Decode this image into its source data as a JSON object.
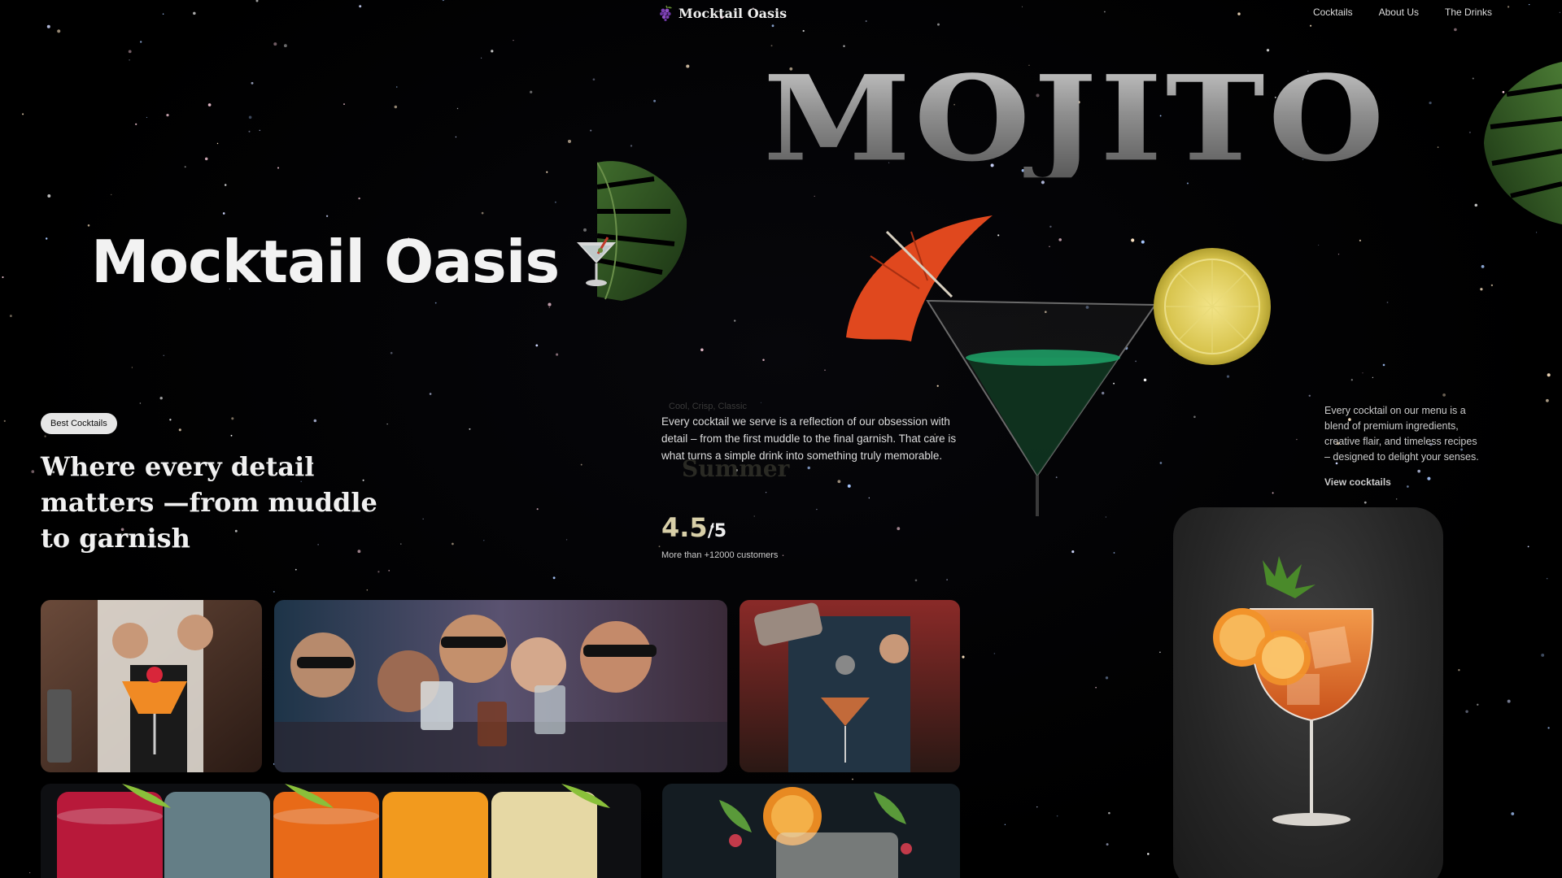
{
  "nav": {
    "brand": "Mocktail Oasis",
    "brand_icon": "grapes-icon",
    "links": [
      "Cocktails",
      "About Us",
      "The Drinks"
    ]
  },
  "hero": {
    "title": "Mocktail Oasis",
    "title_icon": "cocktail-glass-icon",
    "feature_word": "MOJITO"
  },
  "section": {
    "badge": "Best Cocktails",
    "tagline": "Where every detail matters —from muddle to garnish"
  },
  "center": {
    "ghost_subtitle": "Cool, Crisp, Classic",
    "ghost_heading": "Summer",
    "description": "Every cocktail we serve is a reflection of our obsession with detail – from the first muddle to the final garnish. That care is what turns a simple drink into something truly memorable.",
    "rating_value": "4.5",
    "rating_scale": "/5",
    "customers": "More than +12000 customers"
  },
  "right": {
    "description": "Every cocktail on our menu is a blend of premium ingredients, creative flair, and timeless recipes – designed to delight your senses.",
    "link": "View cocktails"
  },
  "colors": {
    "background": "#000000",
    "rating_accent": "#d8cfa8",
    "badge_bg": "#e6e6e6"
  }
}
